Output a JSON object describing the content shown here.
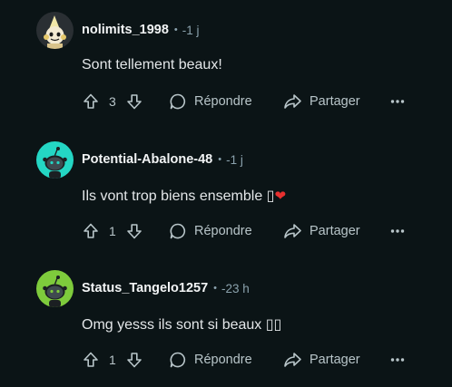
{
  "comments": [
    {
      "username": "nolimits_1998",
      "separator": "•",
      "time": "-1 j",
      "text": "Sont tellement beaux!",
      "emoji": "",
      "votes": "3",
      "reply_label": "Répondre",
      "share_label": "Partager",
      "more_label": "•••",
      "avatar": "snoo-pale-avatar"
    },
    {
      "username": "Potential-Abalone-48",
      "separator": "•",
      "time": "-1 j",
      "text": "Ils vont trop biens ensemble ▯",
      "emoji": "❤",
      "votes": "1",
      "reply_label": "Répondre",
      "share_label": "Partager",
      "more_label": "•••",
      "avatar": "snoo-teal-avatar"
    },
    {
      "username": "Status_Tangelo1257",
      "separator": "•",
      "time": "-23 h",
      "text": "Omg yesss ils sont si beaux ▯▯",
      "emoji": "",
      "votes": "1",
      "reply_label": "Répondre",
      "share_label": "Partager",
      "more_label": "•••",
      "avatar": "snoo-green-avatar"
    }
  ],
  "colors": {
    "background": "#0b1416",
    "teal_avatar": "#24d6c4",
    "green_avatar": "#7ecb3c",
    "heart": "#e8302f"
  },
  "icons": [
    "upvote-icon",
    "downvote-icon",
    "reply-bubble-icon",
    "share-arrow-icon",
    "more-options-icon"
  ]
}
